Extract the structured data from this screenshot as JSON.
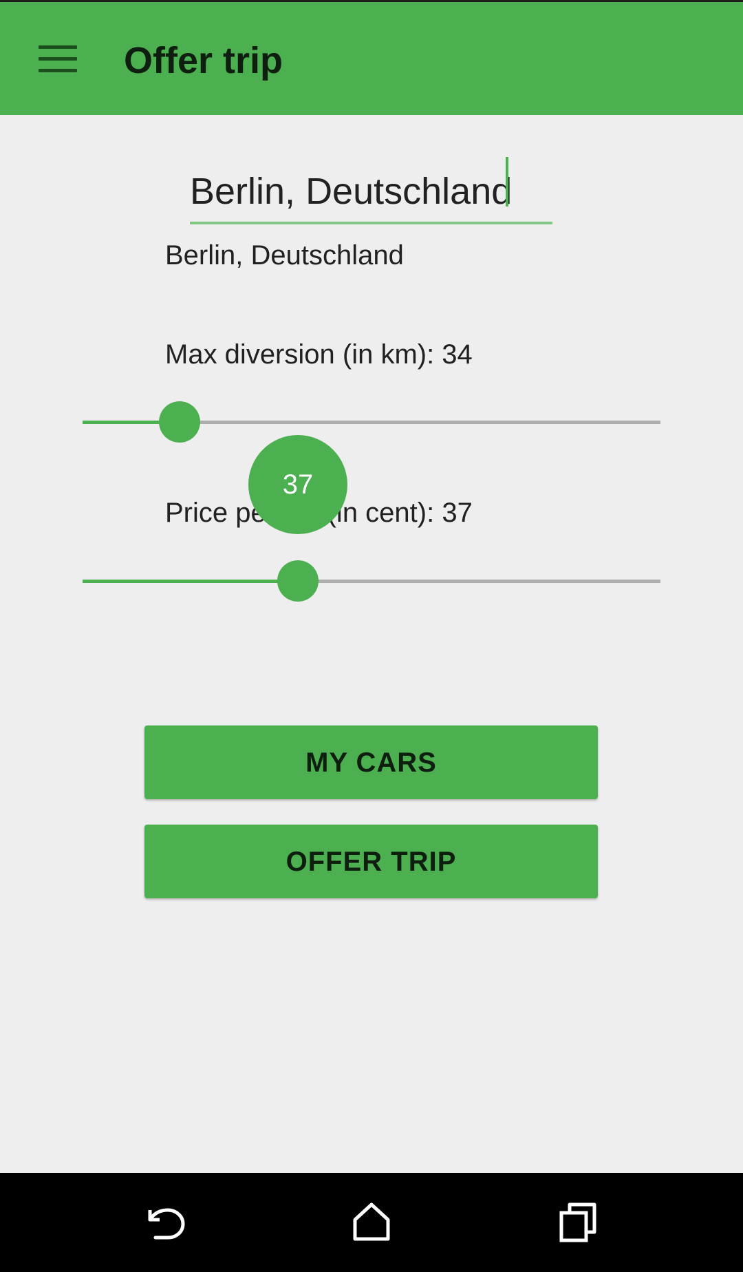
{
  "toolbar": {
    "title": "Offer trip",
    "menu_icon": "hamburger-menu-icon",
    "background_color": "#4CAF50"
  },
  "origin": {
    "value": "Berlin, Deutschland",
    "suggestion": "Berlin, Deutschland"
  },
  "sliders": {
    "diversion": {
      "label": "Max diversion (in km): 34",
      "value": 34,
      "fraction": 0.17
    },
    "price": {
      "label": "Price per km (in cent): 37",
      "value": 37,
      "fraction": 0.37,
      "bubble_value": "37"
    }
  },
  "buttons": {
    "my_cars": "MY CARS",
    "offer_trip": "OFFER TRIP"
  },
  "navbar": {
    "back_icon": "back-icon",
    "home_icon": "home-icon",
    "recents_icon": "recents-icon"
  },
  "colors": {
    "accent": "#4CAF50",
    "track": "#AEAEAE",
    "background": "#EEEEEE"
  }
}
